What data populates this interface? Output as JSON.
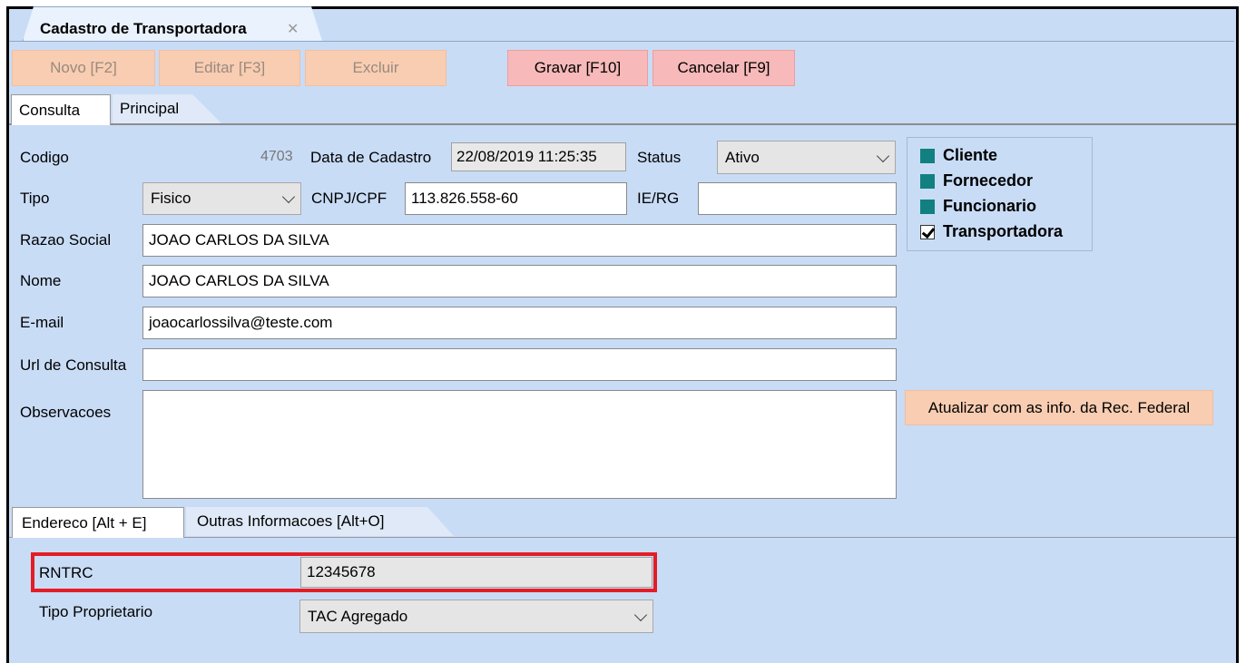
{
  "document_tab": {
    "title": "Cadastro de Transportadora",
    "close": "✕"
  },
  "toolbar": {
    "novo": "Novo [F2]",
    "editar": "Editar [F3]",
    "excluir": "Excluir",
    "gravar": "Gravar [F10]",
    "cancelar": "Cancelar [F9]"
  },
  "page_tabs": {
    "consulta": "Consulta",
    "principal": "Principal"
  },
  "form": {
    "codigo_label": "Codigo",
    "codigo_value": "4703",
    "data_cadastro_label": "Data de Cadastro",
    "data_cadastro_value": "22/08/2019 11:25:35",
    "status_label": "Status",
    "status_value": "Ativo",
    "tipo_label": "Tipo",
    "tipo_value": "Fisico",
    "cnpj_label": "CNPJ/CPF",
    "cnpj_value": "113.826.558-60",
    "ierg_label": "IE/RG",
    "ierg_value": "",
    "razao_label": "Razao Social",
    "razao_value": "JOAO CARLOS DA SILVA",
    "nome_label": "Nome",
    "nome_value": "JOAO CARLOS DA SILVA",
    "email_label": "E-mail",
    "email_value": "joaocarlossilva@teste.com",
    "url_label": "Url de Consulta",
    "url_value": "",
    "obs_label": "Observacoes",
    "obs_value": ""
  },
  "roles": [
    {
      "label": "Cliente",
      "checked": false
    },
    {
      "label": "Fornecedor",
      "checked": false
    },
    {
      "label": "Funcionario",
      "checked": false
    },
    {
      "label": "Transportadora",
      "checked": true
    }
  ],
  "rec_federal_button": "Atualizar com as info. da Rec. Federal",
  "sub_tabs": {
    "endereco": "Endereco [Alt + E]",
    "outras": "Outras Informacoes [Alt+O]"
  },
  "outras": {
    "rntrc_label": "RNTRC",
    "rntrc_value": "12345678",
    "tipo_prop_label": "Tipo Proprietario",
    "tipo_prop_value": "TAC Agregado"
  },
  "colors": {
    "background": "#c9dcf6",
    "highlight": "#e31d25",
    "check_fill": "#128080"
  }
}
